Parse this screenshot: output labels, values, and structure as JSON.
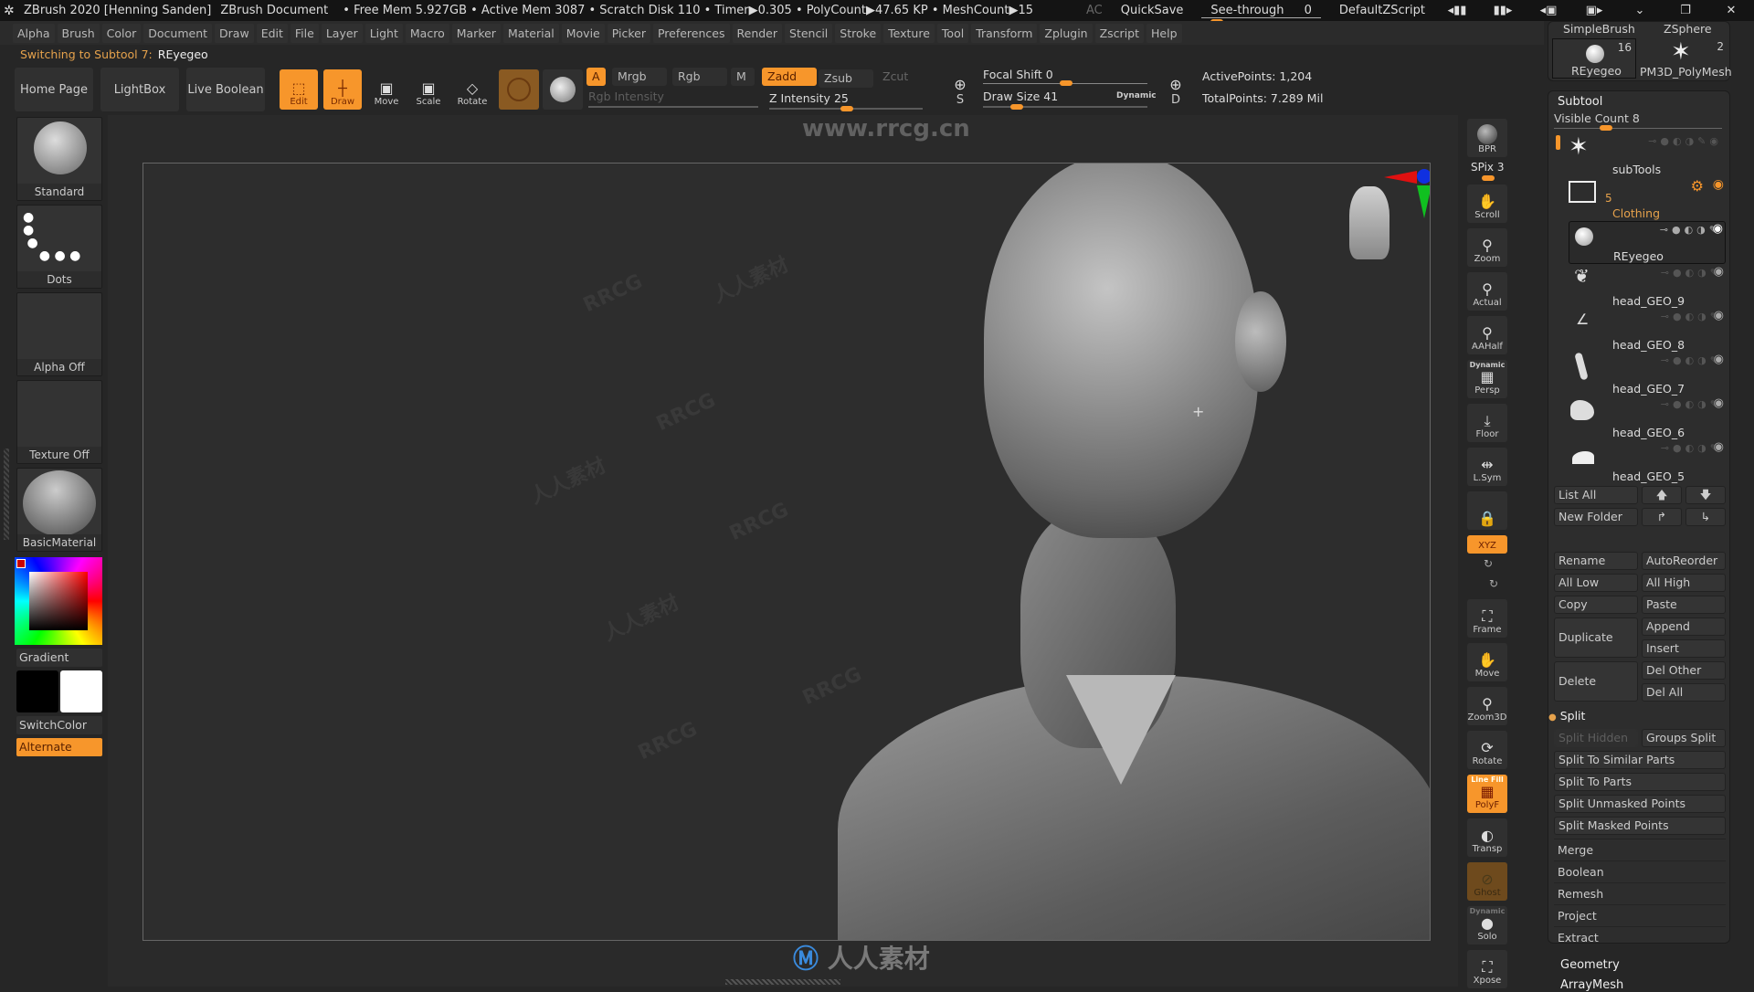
{
  "titlebar": {
    "app": "ZBrush 2020 [Henning Sanden]",
    "document": "ZBrush Document",
    "stats": "• Free Mem 5.927GB • Active Mem 3087 • Scratch Disk 110 • Timer▶0.305 • PolyCount▶47.65 KP • MeshCount▶15",
    "ac": "AC",
    "quicksave": "QuickSave",
    "see_through": "See-through",
    "see_through_value": "0",
    "script": "DefaultZScript"
  },
  "menubar": [
    "Alpha",
    "Brush",
    "Color",
    "Document",
    "Draw",
    "Edit",
    "File",
    "Layer",
    "Light",
    "Macro",
    "Marker",
    "Material",
    "Movie",
    "Picker",
    "Preferences",
    "Render",
    "Stencil",
    "Stroke",
    "Texture",
    "Tool",
    "Transform",
    "Zplugin",
    "Zscript",
    "Help"
  ],
  "notice": {
    "prefix": "Switching to Subtool 7:",
    "name": "REyegeo"
  },
  "toolbar": {
    "home_page": "Home Page",
    "lightbox": "LightBox",
    "live_boolean": "Live Boolean",
    "edit": "Edit",
    "draw": "Draw",
    "move": "Move",
    "scale": "Scale",
    "rotate": "Rotate",
    "a": "A",
    "mrgb": "Mrgb",
    "rgb": "Rgb",
    "m": "M",
    "zadd": "Zadd",
    "zsub": "Zsub",
    "zcut": "Zcut",
    "rgb_intensity": "Rgb Intensity",
    "z_intensity_label": "Z Intensity",
    "z_intensity": "25",
    "focal_shift_label": "Focal Shift",
    "focal_shift": "0",
    "draw_size_label": "Draw Size",
    "draw_size": "41",
    "dynamic": "Dynamic",
    "active_points": "ActivePoints: 1,204",
    "total_points": "TotalPoints: 7.289 Mil",
    "s_letter": "S",
    "d_letter": "D"
  },
  "leftpanel": {
    "brush": "Standard",
    "stroke": "Dots",
    "alpha": "Alpha Off",
    "texture": "Texture Off",
    "material": "BasicMaterial",
    "gradient": "Gradient",
    "switchcolor": "SwitchColor",
    "alternate": "Alternate",
    "main_color": "#000000",
    "secondary_color": "#ffffff"
  },
  "rshelf": {
    "bpr": "BPR",
    "spix": "SPix 3",
    "scroll": "Scroll",
    "zoom": "Zoom",
    "actual": "Actual",
    "aahalf": "AAHalf",
    "persp_dynamic": "Dynamic",
    "persp": "Persp",
    "floor": "Floor",
    "lsym": "L.Sym",
    "xyz": "XYZ",
    "frame": "Frame",
    "move": "Move",
    "zoom3d": "Zoom3D",
    "rotate": "Rotate",
    "linefill": "Line Fill",
    "polyf": "PolyF",
    "transp": "Transp",
    "ghost": "Ghost",
    "solo_dynamic": "Dynamic",
    "solo": "Solo",
    "xpose": "Xpose"
  },
  "rightpanel": {
    "tools": [
      {
        "name": "SimpleBrush"
      },
      {
        "name": "ZSphere"
      },
      {
        "name": "REyegeo",
        "count": "16"
      },
      {
        "name": "PM3D_PolyMesh",
        "count": "2"
      }
    ],
    "subtool_title": "Subtool",
    "visible_count": "Visible Count 8",
    "folder_count": "5",
    "subtools": [
      {
        "name": "subTools"
      },
      {
        "name": "Clothing",
        "folder": true
      },
      {
        "name": "REyegeo",
        "selected": true
      },
      {
        "name": "head_GEO_9"
      },
      {
        "name": "head_GEO_8"
      },
      {
        "name": "head_GEO_7"
      },
      {
        "name": "head_GEO_6"
      },
      {
        "name": "head_GEO_5"
      }
    ],
    "list_all": "List All",
    "new_folder": "New Folder",
    "rename": "Rename",
    "autoreorder": "AutoReorder",
    "all_low": "All Low",
    "all_high": "All High",
    "copy": "Copy",
    "paste": "Paste",
    "duplicate": "Duplicate",
    "append": "Append",
    "insert": "Insert",
    "delete": "Delete",
    "del_other": "Del Other",
    "del_all": "Del All",
    "split": "Split",
    "split_hidden": "Split Hidden",
    "groups_split": "Groups Split",
    "split_similar": "Split To Similar Parts",
    "split_parts": "Split To Parts",
    "split_unmasked": "Split Unmasked Points",
    "split_masked": "Split Masked Points",
    "merge": "Merge",
    "boolean": "Boolean",
    "remesh": "Remesh",
    "project": "Project",
    "extract": "Extract",
    "geometry": "Geometry",
    "arraymesh": "ArrayMesh"
  },
  "watermark": {
    "site": "www.rrcg.cn",
    "brand": "人人素材",
    "tag": "RRCG"
  },
  "colors": {
    "accent": "#f7962b",
    "notice": "#e6a24c",
    "bg": "#262626"
  }
}
